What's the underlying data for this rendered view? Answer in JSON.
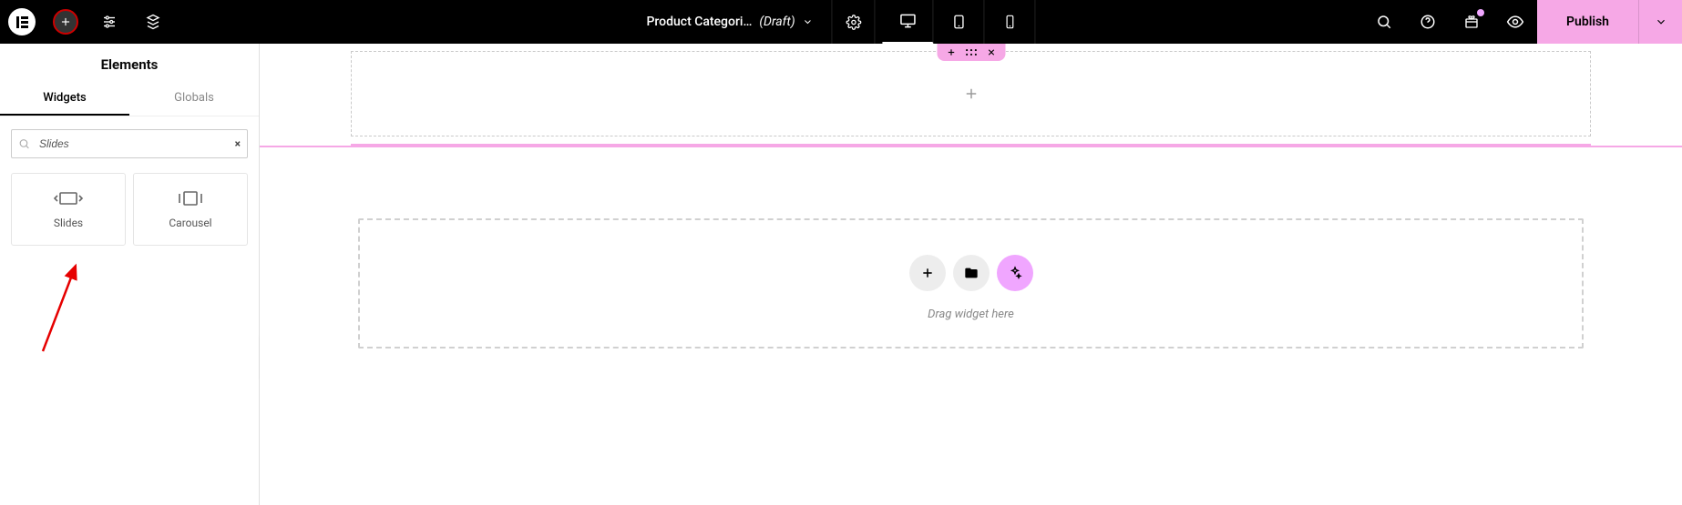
{
  "topbar": {
    "doc_title": "Product Categori…",
    "doc_status": "(Draft)",
    "publish_label": "Publish"
  },
  "panel": {
    "title": "Elements",
    "tabs": {
      "widgets": "Widgets",
      "globals": "Globals"
    },
    "search_value": "Slides",
    "search_clear": "×"
  },
  "widgets": [
    {
      "label": "Slides",
      "icon": "slides-icon"
    },
    {
      "label": "Carousel",
      "icon": "carousel-icon"
    }
  ],
  "dropzone": {
    "text": "Drag widget here"
  },
  "colors": {
    "accent_pink": "#f6a8e6"
  }
}
